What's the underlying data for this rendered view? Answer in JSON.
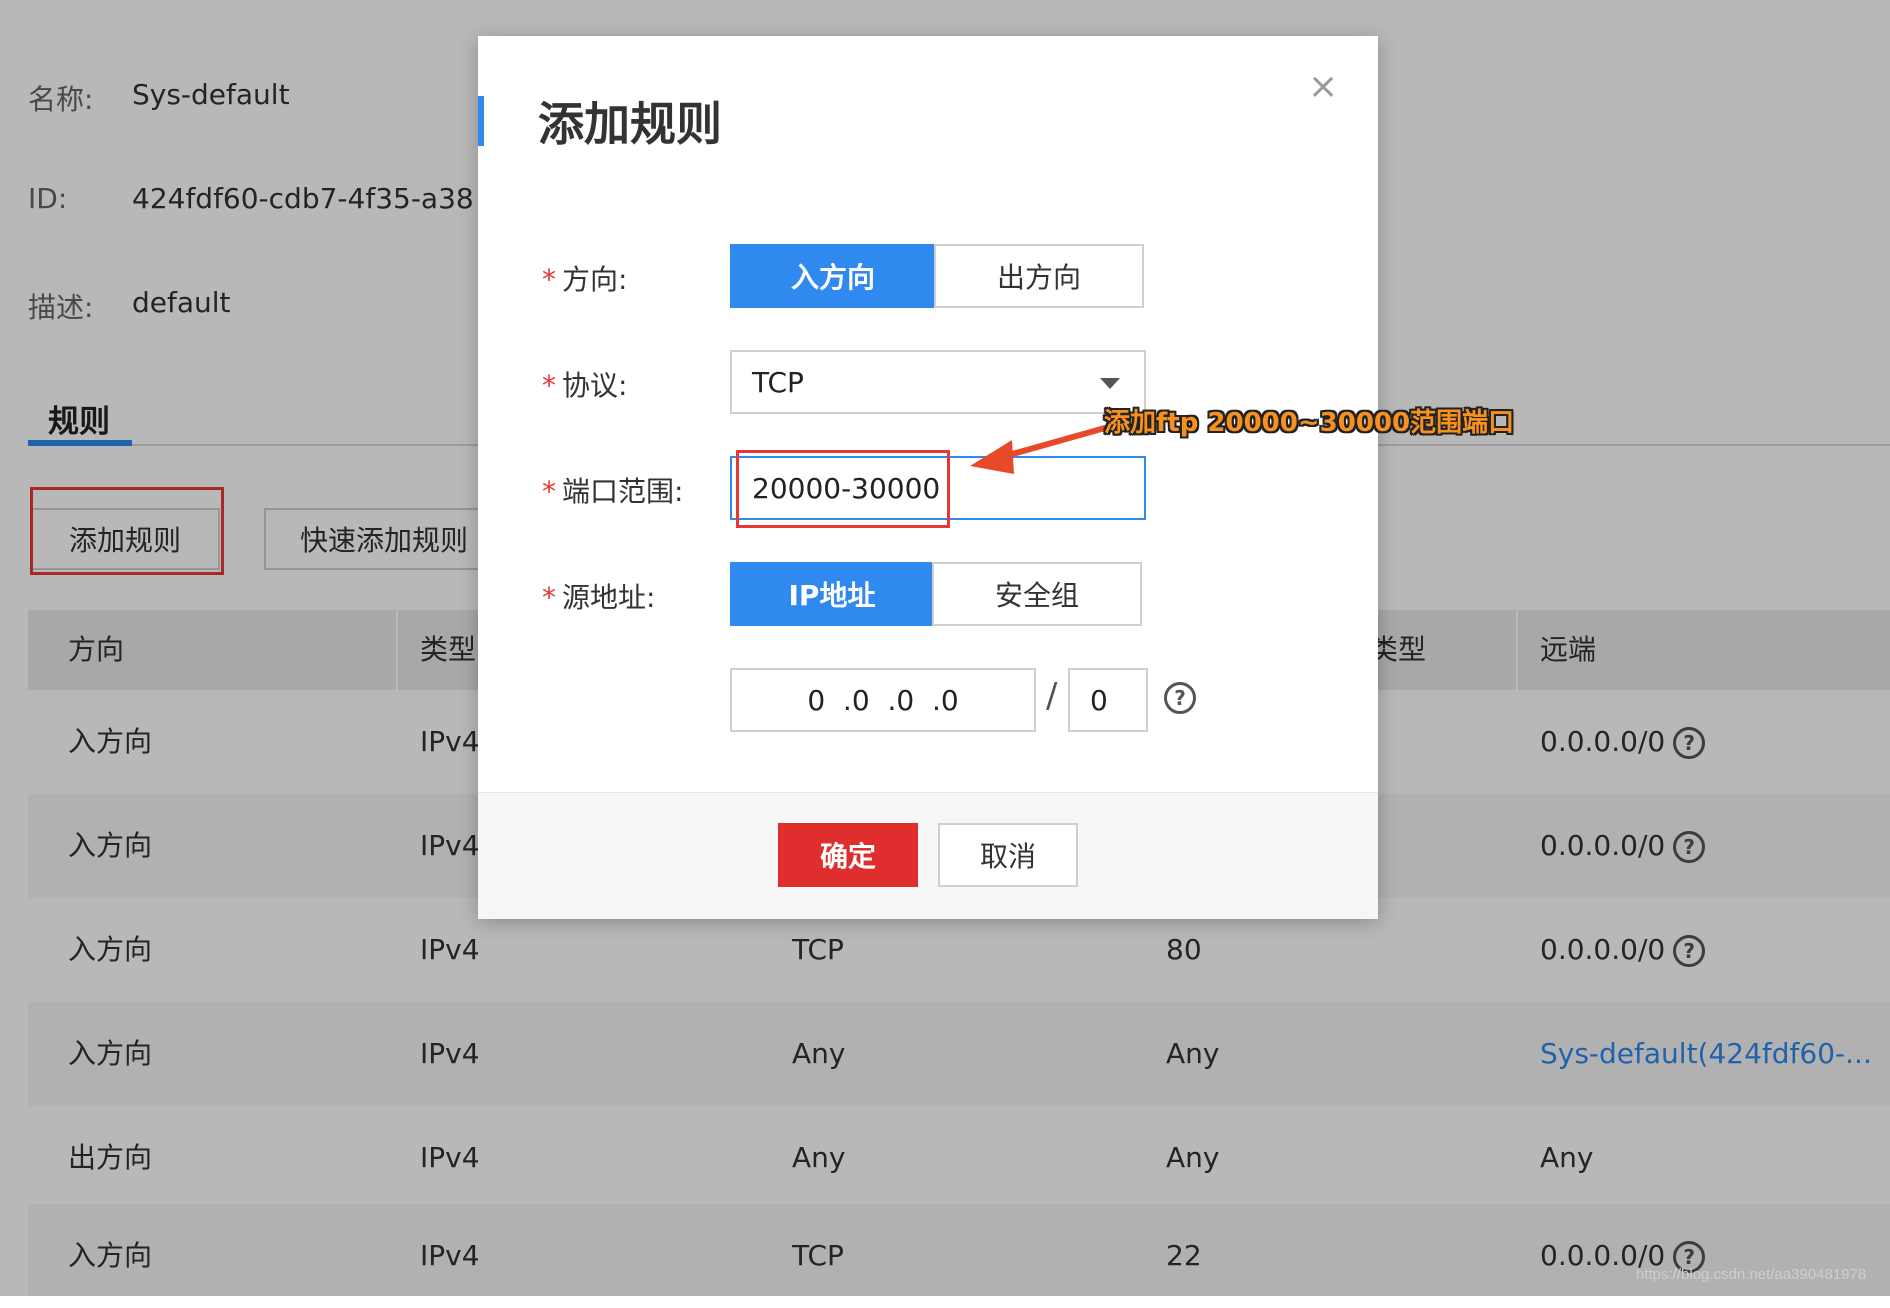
{
  "page": {
    "info": {
      "name_label": "名称:",
      "name_value": "Sys-default",
      "id_label": "ID:",
      "id_value": "424fdf60-cdb7-4f35-a38",
      "desc_label": "描述:",
      "desc_value": "default"
    },
    "tab_label": "规则",
    "add_rule_label": "添加规则",
    "quick_add_label": "快速添加规则",
    "table": {
      "headers": [
        "方向",
        "类型",
        "",
        "类型",
        "远端"
      ],
      "rows": [
        {
          "direction": "入方向",
          "type": "IPv4",
          "protocol": "",
          "port": "",
          "remote": "0.0.0.0/0",
          "help": true,
          "link": false
        },
        {
          "direction": "入方向",
          "type": "IPv4",
          "protocol": "",
          "port": "",
          "remote": "0.0.0.0/0",
          "help": true,
          "link": false
        },
        {
          "direction": "入方向",
          "type": "IPv4",
          "protocol": "TCP",
          "port": "80",
          "remote": "0.0.0.0/0",
          "help": true,
          "link": false
        },
        {
          "direction": "入方向",
          "type": "IPv4",
          "protocol": "Any",
          "port": "Any",
          "remote": "Sys-default(424fdf60-...",
          "help": false,
          "link": true
        },
        {
          "direction": "出方向",
          "type": "IPv4",
          "protocol": "Any",
          "port": "Any",
          "remote": "Any",
          "help": false,
          "link": false
        },
        {
          "direction": "入方向",
          "type": "IPv4",
          "protocol": "TCP",
          "port": "22",
          "remote": "0.0.0.0/0",
          "help": true,
          "link": false
        }
      ]
    }
  },
  "modal": {
    "title": "添加规则",
    "close_symbol": "×",
    "direction": {
      "label": "方向:",
      "options": [
        "入方向",
        "出方向"
      ],
      "selected": "入方向"
    },
    "protocol": {
      "label": "协议:",
      "value": "TCP"
    },
    "port_range": {
      "label": "端口范围:",
      "value": "20000-30000"
    },
    "source": {
      "label": "源地址:",
      "options": [
        "IP地址",
        "安全组"
      ],
      "selected": "IP地址"
    },
    "ip": {
      "value": "0  .0  .0  .0",
      "separator": "/",
      "mask": "0"
    },
    "confirm_label": "确定",
    "cancel_label": "取消"
  },
  "annotation": {
    "text": "添加ftp 20000~30000范围端口"
  },
  "watermark": "https://blog.csdn.net/aa390481978",
  "colors": {
    "primary": "#2f89ee",
    "danger": "#e02e2e",
    "annotation": "#f7901e"
  }
}
